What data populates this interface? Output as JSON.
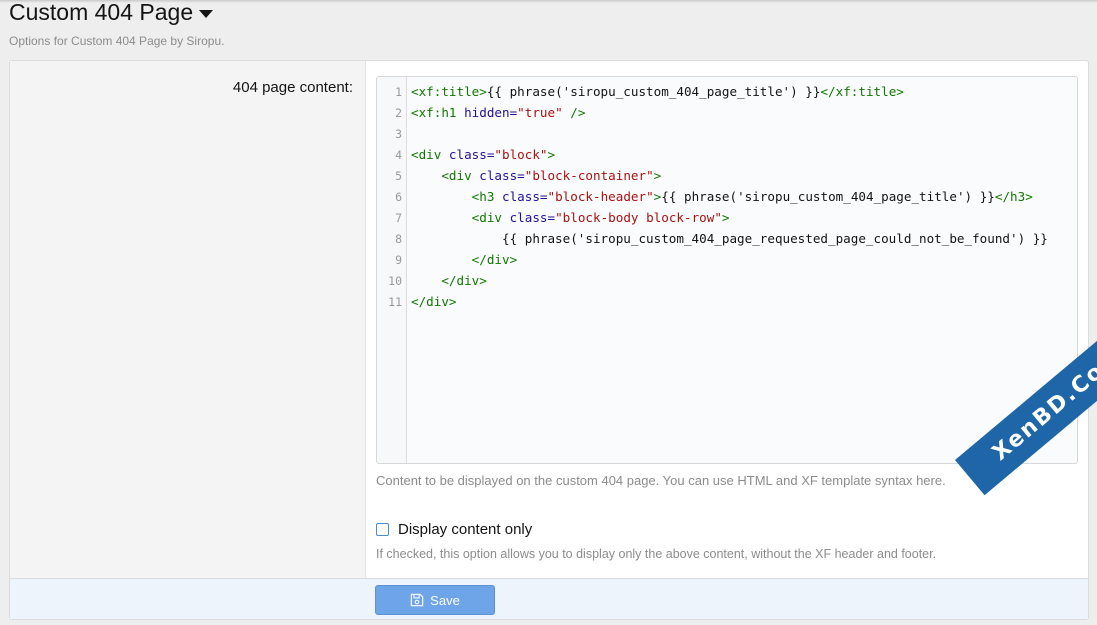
{
  "header": {
    "title": "Custom 404 Page",
    "description": "Options for Custom 404 Page by Siropu."
  },
  "form": {
    "content_label": "404 page content:",
    "editor": {
      "line_numbers": [
        "1",
        "2",
        "3",
        "4",
        "5",
        "6",
        "7",
        "8",
        "9",
        "10",
        "11"
      ],
      "lines": [
        [
          {
            "t": "tag",
            "v": "<xf:title>"
          },
          {
            "t": "txt",
            "v": "{{ phrase('siropu_custom_404_page_title') }}"
          },
          {
            "t": "tag",
            "v": "</xf:title>"
          }
        ],
        [
          {
            "t": "tag",
            "v": "<xf:h1 "
          },
          {
            "t": "attr",
            "v": "hidden="
          },
          {
            "t": "str",
            "v": "\"true\""
          },
          {
            "t": "tag",
            "v": " />"
          }
        ],
        [],
        [
          {
            "t": "tag",
            "v": "<div "
          },
          {
            "t": "attr",
            "v": "class="
          },
          {
            "t": "str",
            "v": "\"block\""
          },
          {
            "t": "tag",
            "v": ">"
          }
        ],
        [
          {
            "t": "txt",
            "v": "    "
          },
          {
            "t": "tag",
            "v": "<div "
          },
          {
            "t": "attr",
            "v": "class="
          },
          {
            "t": "str",
            "v": "\"block-container\""
          },
          {
            "t": "tag",
            "v": ">"
          }
        ],
        [
          {
            "t": "txt",
            "v": "        "
          },
          {
            "t": "tag",
            "v": "<h3 "
          },
          {
            "t": "attr",
            "v": "class="
          },
          {
            "t": "str",
            "v": "\"block-header\""
          },
          {
            "t": "tag",
            "v": ">"
          },
          {
            "t": "txt",
            "v": "{{ phrase('siropu_custom_404_page_title') }}"
          },
          {
            "t": "tag",
            "v": "</h3>"
          }
        ],
        [
          {
            "t": "txt",
            "v": "        "
          },
          {
            "t": "tag",
            "v": "<div "
          },
          {
            "t": "attr",
            "v": "class="
          },
          {
            "t": "str",
            "v": "\"block-body block-row\""
          },
          {
            "t": "tag",
            "v": ">"
          }
        ],
        [
          {
            "t": "txt",
            "v": "            {{ phrase('siropu_custom_404_page_requested_page_could_not_be_found') }}"
          }
        ],
        [
          {
            "t": "txt",
            "v": "        "
          },
          {
            "t": "tag",
            "v": "</div>"
          }
        ],
        [
          {
            "t": "txt",
            "v": "    "
          },
          {
            "t": "tag",
            "v": "</div>"
          }
        ],
        [
          {
            "t": "tag",
            "v": "</div>"
          }
        ]
      ]
    },
    "content_hint": "Content to be displayed on the custom 404 page. You can use HTML and XF template syntax here.",
    "display_only": {
      "label": "Display content only",
      "checked": false,
      "hint": "If checked, this option allows you to display only the above content, without the XF header and footer."
    },
    "save_label": "Save"
  },
  "watermark": {
    "text": "XenBD.Com"
  },
  "colors": {
    "accent": "#6da5e8",
    "tag": "#117700",
    "attr": "#221199",
    "string": "#aa1111",
    "watermark": "#1e66a8"
  },
  "icons": {
    "title_menu": "caret-down-icon",
    "save": "floppy-disk-icon"
  }
}
